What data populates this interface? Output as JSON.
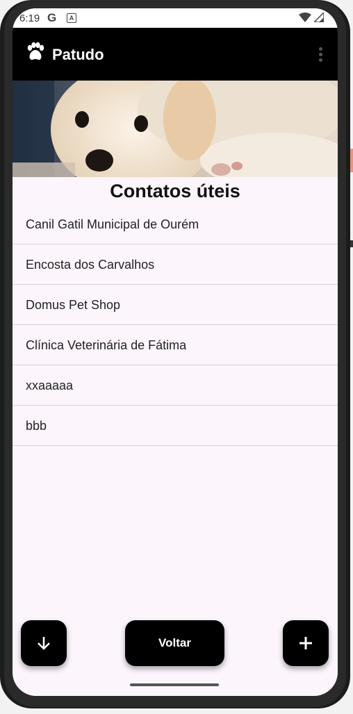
{
  "status_bar": {
    "time": "6:19",
    "icons": [
      "google-g-icon",
      "text-a-icon",
      "wifi-icon",
      "signal-icon"
    ]
  },
  "app_bar": {
    "title": "Patudo",
    "logo_icon": "paw-icon",
    "menu_icon": "overflow-menu-icon"
  },
  "banner": {
    "image": "puppy-photo"
  },
  "page_title": "Contatos úteis",
  "contacts": [
    "Canil Gatil Municipal de Ourém",
    "Encosta dos Carvalhos",
    "Domus Pet Shop",
    "Clínica Veterinária de Fátima",
    "xxaaaaa",
    "bbb"
  ],
  "buttons": {
    "scroll_down_icon": "arrow-down-icon",
    "back_label": "Voltar",
    "add_icon": "plus-icon"
  },
  "colors": {
    "app_bar": "#000000",
    "background": "#fcf5fc",
    "divider": "#d8d2d8",
    "button": "#000000"
  }
}
